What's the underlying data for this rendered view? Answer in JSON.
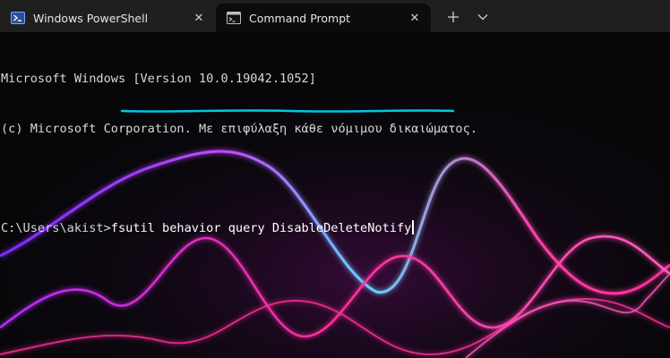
{
  "tabs": [
    {
      "title": "Windows PowerShell",
      "icon": "powershell-icon",
      "active": false
    },
    {
      "title": "Command Prompt",
      "icon": "cmd-icon",
      "active": true
    }
  ],
  "tabbar": {
    "new_tab_icon": "plus-icon",
    "dropdown_icon": "chevron-down-icon",
    "close_glyph": "✕"
  },
  "terminal": {
    "lines": [
      "Microsoft Windows [Version 10.0.19042.1052]",
      "(c) Microsoft Corporation. Με επιφύλαξη κάθε νόμιμου δικαιώματος."
    ],
    "prompt": "C:\\Users\\akist>",
    "command": "fsutil behavior query DisableDeleteNotify",
    "highlight_color": "#00c8e6"
  },
  "colors": {
    "tabbar_bg": "#1f1f1f",
    "terminal_bg": "#07070a",
    "text": "#d8d8d8",
    "wave_pink": "#ff2d9a",
    "wave_violet": "#b347ff",
    "wave_cyan": "#59d8ff"
  }
}
